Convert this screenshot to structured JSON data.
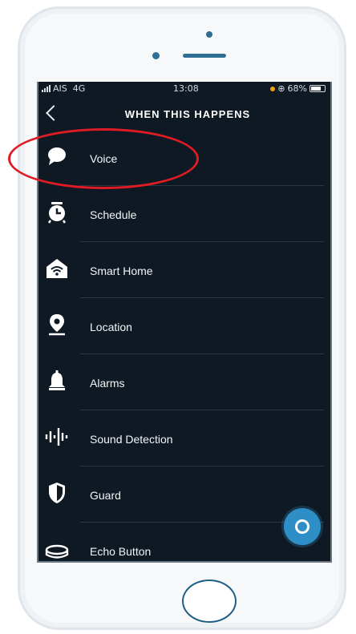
{
  "status_bar": {
    "carrier": "AIS",
    "network": "4G",
    "time": "13:08",
    "battery": "68%"
  },
  "header": {
    "back_icon": "chevron-left-icon",
    "title": "WHEN THIS HAPPENS"
  },
  "triggers": [
    {
      "label": "Voice",
      "icon": "speech-bubble-icon"
    },
    {
      "label": "Schedule",
      "icon": "alarm-clock-icon"
    },
    {
      "label": "Smart Home",
      "icon": "wifi-home-icon"
    },
    {
      "label": "Location",
      "icon": "location-pin-icon"
    },
    {
      "label": "Alarms",
      "icon": "bell-icon"
    },
    {
      "label": "Sound Detection",
      "icon": "sound-wave-icon"
    },
    {
      "label": "Guard",
      "icon": "shield-icon"
    },
    {
      "label": "Echo Button",
      "icon": "echo-button-icon"
    }
  ],
  "alexa_button": {
    "icon": "alexa-icon",
    "color": "#2e8fc6"
  },
  "annotation": {
    "highlight_color": "#e01b24"
  }
}
